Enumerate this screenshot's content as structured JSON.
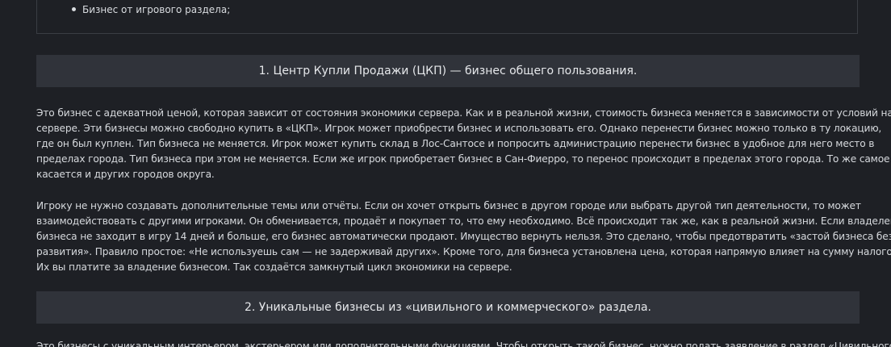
{
  "list": {
    "items": [
      "Бизнес от игрового раздела;"
    ]
  },
  "sections": [
    {
      "heading": "1. Центр Купли Продажи (ЦКП) — бизнес общего пользования.",
      "paragraphs": [
        [
          "Это бизнес с адекватной ценой, которая зависит от состояния экономики сервера. Как и в реальной жизни, стоимость бизнеса меняется в зависимости от условий на",
          "сервере. Эти бизнесы можно свободно купить в «ЦКП». Игрок может приобрести бизнес и использовать его. Однако перенести бизнес можно только в ту локацию,",
          "где он был куплен. Тип бизнеса не меняется. Игрок может купить склад в Лос-Сантосе и попросить администрацию перенести бизнес в удобное для него место в",
          "пределах города. Тип бизнеса при этом не меняется. Если же игрок приобретает бизнес в Сан-Фиерро, то перенос происходит в пределах этого города. То же самое",
          "касается и других городов округа."
        ],
        [
          "Игроку не нужно создавать дополнительные темы или отчёты. Если он хочет открыть бизнес в другом городе или выбрать другой тип деятельности, то может",
          "взаимодействовать с другими игроками. Он обменивается, продаёт и покупает то, что ему необходимо. Всё происходит так же, как в реальной жизни. Если владелец",
          "бизнеса не заходит в игру 14 дней и больше, его бизнес автоматически продают. Имущество вернуть нельзя. Это сделано, чтобы предотвратить «застой бизнеса без",
          "развития». Правило простое: «Не используешь сам — не задерживай других». Кроме того, для бизнеса установлена цена, которая напрямую влияет на сумму налогов.",
          "Их вы платите за владение бизнесом. Так создаётся замкнутый цикл экономики на сервере."
        ]
      ]
    },
    {
      "heading": "2. Уникальные бизнесы из «цивильного и коммерческого» раздела.",
      "paragraphs": [
        [
          "Это бизнесы с уникальным интерьером, экстерьером или дополнительными функциями. Чтобы открыть такой бизнес, нужно подать заявление в раздел «Цивильного и"
        ]
      ]
    }
  ]
}
